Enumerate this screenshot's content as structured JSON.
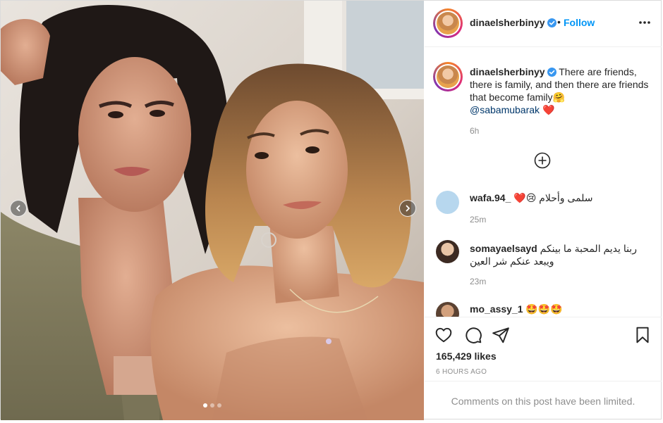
{
  "post": {
    "username": "dinaelsherbinyy",
    "separator": "•",
    "follow_label": "Follow",
    "caption": {
      "username": "dinaelsherbinyy",
      "text": "There are friends, there is family, and then there are friends that become family🤗",
      "mention": "@sabamubarak",
      "heart": "❤️",
      "time": "6h"
    },
    "comments": [
      {
        "username": "wafa.94_",
        "text": "سلمى وأحلام 😢❤️",
        "time": "25m"
      },
      {
        "username": "somayaelsayd",
        "text": "ربنا يديم المحبة ما بينكم ويبعد عنكم شر العين",
        "time": "23m"
      },
      {
        "username": "mo_assy_1",
        "text": "🤩🤩🤩",
        "time": ""
      }
    ],
    "likes": "165,429 likes",
    "posted_ago": "6 HOURS AGO",
    "comments_limited": "Comments on this post have been limited.",
    "carousel": {
      "slide_count": 3,
      "active_index": 0
    },
    "icons": {
      "verified": "verified-badge-icon",
      "more": "more-options-icon",
      "load_more": "load-more-comments-icon",
      "like": "heart-icon",
      "comment": "comment-icon",
      "share": "share-icon",
      "save": "bookmark-icon",
      "prev": "chevron-left-icon",
      "next": "chevron-right-icon"
    },
    "colors": {
      "link": "#0095f6",
      "verified": "#3897f0",
      "muted": "#8e8e8e",
      "mention": "#00376b"
    }
  }
}
